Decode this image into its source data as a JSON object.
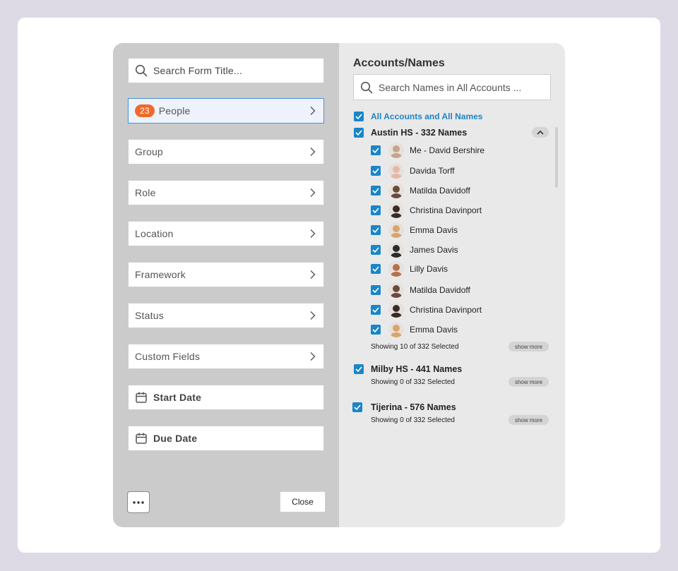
{
  "filters": {
    "search_placeholder": "Search Form Title...",
    "people": {
      "badge": "23",
      "label": "People"
    },
    "group": "Group",
    "role": "Role",
    "location": "Location",
    "framework": "Framework",
    "status": "Status",
    "custom_fields": "Custom Fields",
    "start_date": "Start Date",
    "due_date": "Due Date",
    "close_label": "Close"
  },
  "accounts": {
    "title": "Accounts/Names",
    "search_placeholder": "Search Names in All Accounts ...",
    "all_label": "All Accounts and All Names",
    "groups": [
      {
        "name": "Austin HS - 332 Names",
        "people": [
          "Me - David Bershire",
          "Davida Torff",
          "Matilda Davidoff",
          "Christina Davinport",
          "Emma Davis",
          "James Davis",
          "Lilly Davis",
          "Matilda Davidoff",
          "Christina Davinport",
          "Emma Davis"
        ],
        "showing": "Showing 10 of 332 Selected",
        "show_more": "show more"
      },
      {
        "name": "Milby HS - 441 Names",
        "showing": "Showing 0 of 332 Selected",
        "show_more": "show more"
      },
      {
        "name": "Tijerina - 576 Names",
        "showing": "Showing 0 of 332 Selected",
        "show_more": "show more"
      }
    ]
  },
  "colors": {
    "accent": "#1a86c8",
    "badge": "#ef6a2a",
    "left_bg": "#cbcbcb",
    "right_bg": "#e9e9e9"
  }
}
